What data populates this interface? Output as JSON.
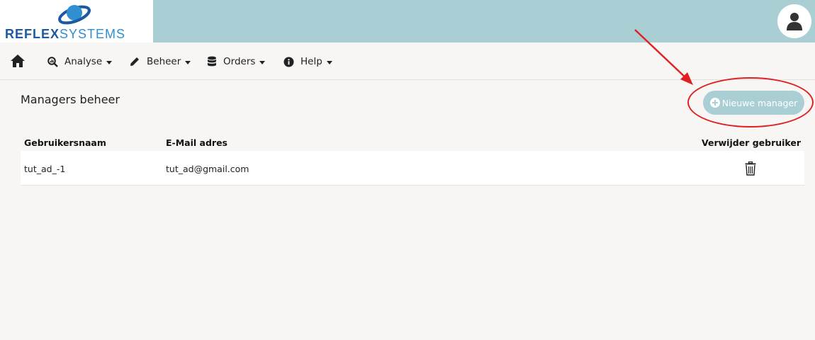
{
  "brand": {
    "name_bold": "REFLEX",
    "name_light": "SYSTEMS",
    "logo_icon": "globe-emblem-icon",
    "colors": {
      "primary": "#1b5aa0",
      "secondary": "#2f8fd0"
    }
  },
  "header": {
    "background": "#a9cfd5",
    "user_icon": "user-icon"
  },
  "nav": {
    "home_icon": "home-icon",
    "items": [
      {
        "label": "Analyse",
        "icon": "search-chart-icon"
      },
      {
        "label": "Beheer",
        "icon": "pencil-icon"
      },
      {
        "label": "Orders",
        "icon": "database-icon"
      },
      {
        "label": "Help",
        "icon": "info-icon"
      }
    ]
  },
  "main": {
    "title": "Managers beheer",
    "new_button_label": "Nieuwe manager",
    "table": {
      "headers": [
        "Gebruikersnaam",
        "E-Mail adres",
        "Verwijder gebruiker"
      ],
      "rows": [
        {
          "username": "tut_ad_-1",
          "email": "tut_ad@gmail.com",
          "delete_icon": "trash-icon"
        }
      ]
    }
  },
  "annotation": {
    "color": "#e02020"
  }
}
